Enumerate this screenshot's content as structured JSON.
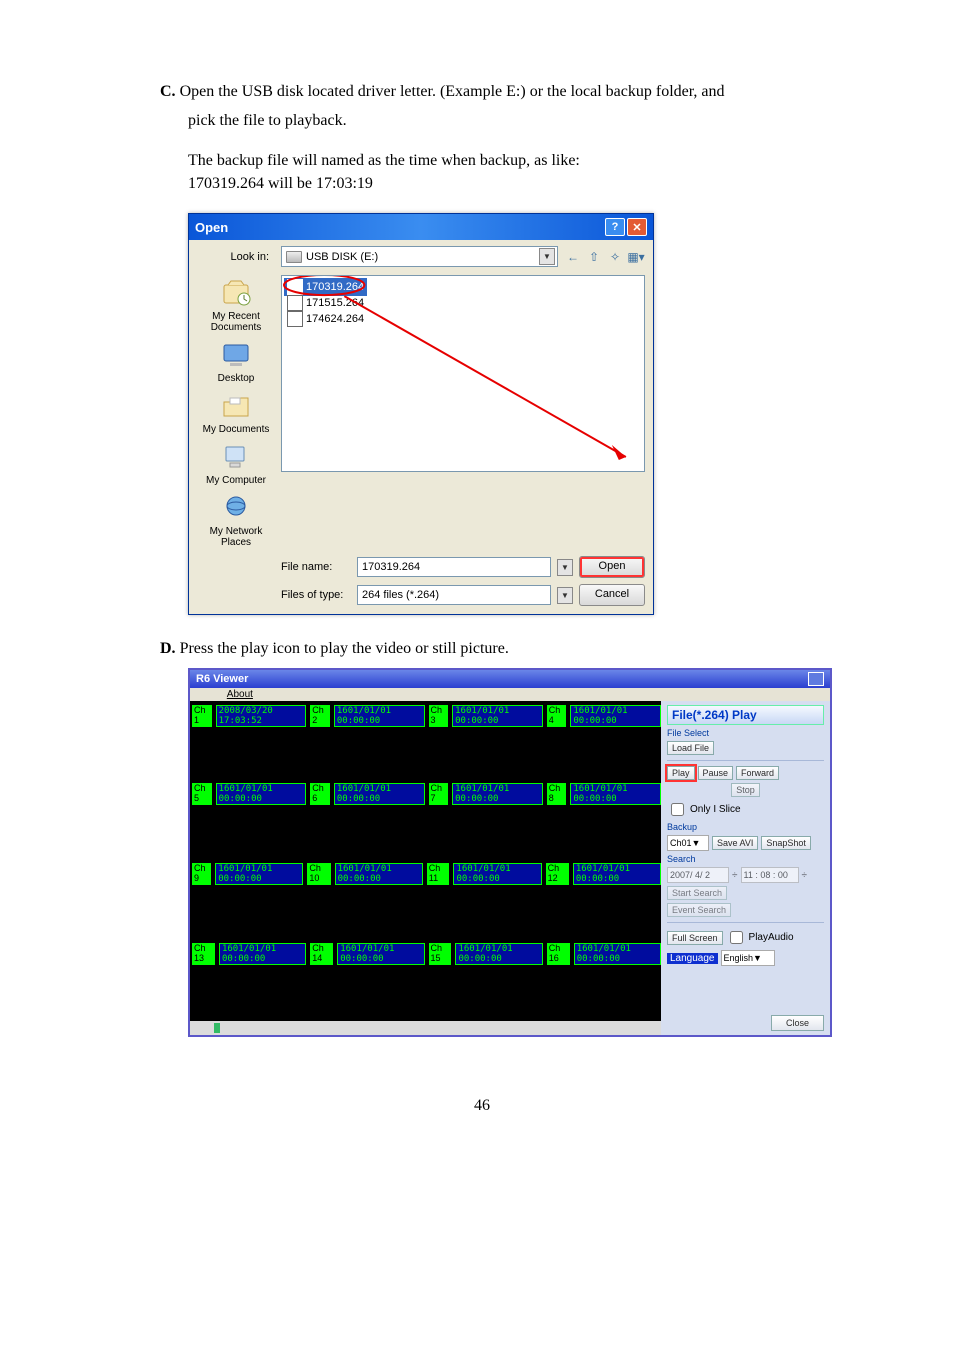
{
  "doc": {
    "step_c_label": "C.",
    "step_c_text1": "Open the USB disk located driver letter. (Example E:) or the local backup folder, and",
    "step_c_text2": "pick the file to playback.",
    "step_c_note1": "The backup file will named as the time when backup, as like:",
    "step_c_note2": "170319.264 will be 17:03:19",
    "step_d_label": "D.",
    "step_d_text": "Press the play icon to play the video or still picture.",
    "page_number": "46"
  },
  "opendlg": {
    "title": "Open",
    "lookin_label": "Look in:",
    "drive": "USB DISK (E:)",
    "files": [
      "170319.264",
      "171515.264",
      "174624.264"
    ],
    "file_name_label": "File name:",
    "file_name_value": "170319.264",
    "type_label": "Files of type:",
    "type_value": "264 files (*.264)",
    "open_btn": "Open",
    "cancel_btn": "Cancel"
  },
  "places": {
    "recent": "My Recent Documents",
    "desktop": "Desktop",
    "mydocs": "My Documents",
    "mycomp": "My Computer",
    "mynet": "My Network Places"
  },
  "viewer": {
    "title": "R6 Viewer",
    "menu_about": "About",
    "channel_idle_ts": "1601/01/01 00:00:00",
    "channel_active_ts": "2008/03/20 17:03:52",
    "right_title": "File(*.264) Play",
    "file_select": "File Select",
    "load_file": "Load File",
    "play": "Play",
    "pause": "Pause",
    "forward": "Forward",
    "stop": "Stop",
    "only_i_slice": "Only I Slice",
    "backup": "Backup",
    "ch_sel": "Ch01",
    "save_avi": "Save AVI",
    "snapshot": "SnapShot",
    "search": "Search",
    "search_date": "2007/ 4/ 2",
    "search_time": "11 : 08 : 00",
    "start_search": "Start Search",
    "event_search": "Event Search",
    "full_screen": "Full Screen",
    "play_audio": "PlayAudio",
    "language": "Language",
    "lang_value": "English",
    "close": "Close",
    "channels": [
      "Ch 1",
      "Ch 2",
      "Ch 3",
      "Ch 4",
      "Ch 5",
      "Ch 6",
      "Ch 7",
      "Ch 8",
      "Ch 9",
      "Ch 10",
      "Ch 11",
      "Ch 12",
      "Ch 13",
      "Ch 14",
      "Ch 15",
      "Ch 16"
    ]
  }
}
